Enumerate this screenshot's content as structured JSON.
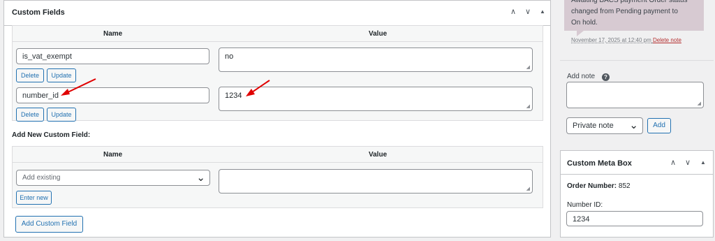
{
  "custom_fields": {
    "title": "Custom Fields",
    "columns": {
      "name": "Name",
      "value": "Value"
    },
    "rows": [
      {
        "name": "is_vat_exempt",
        "value": "no"
      },
      {
        "name": "number_id",
        "value": "1234"
      }
    ],
    "row_buttons": {
      "delete": "Delete",
      "update": "Update"
    },
    "add_new_label": "Add New Custom Field:",
    "new_field": {
      "select_placeholder": "Add existing",
      "enter_new_label": "Enter new",
      "add_button_label": "Add Custom Field"
    }
  },
  "order_notes": {
    "note_text_line1": "Awaiting BACS payment Order status",
    "note_text_line2": "changed from Pending payment to",
    "note_text_line3": "On hold.",
    "note_date": "November 17, 2025 at 12:40 pm",
    "delete_note_label": "Delete note",
    "add_note_label": "Add note",
    "note_type_selected": "Private note",
    "add_button_label": "Add"
  },
  "custom_meta_box": {
    "title": "Custom Meta Box",
    "order_number_label": "Order Number:",
    "order_number_value": "852",
    "number_id_label": "Number ID:",
    "number_id_value": "1234"
  },
  "header_controls": {
    "up": "∧",
    "down": "∨",
    "toggle": "▲"
  },
  "icons": {
    "help": "help-icon",
    "chevron": "chevron-down-icon",
    "resize": "resize-grip-icon",
    "annotation": "red-arrow-icon"
  },
  "colors": {
    "accent": "#2271b1",
    "note_bg": "#d7cad2",
    "delete": "#b32d2e",
    "arrow": "#e00000"
  }
}
